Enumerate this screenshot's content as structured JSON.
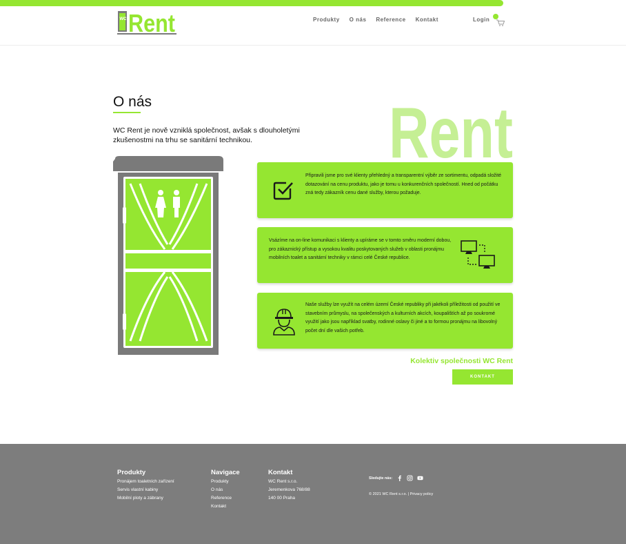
{
  "header": {
    "logo_small": "WC",
    "logo_text": "Rent",
    "nav": [
      "Produkty",
      "O nás",
      "Reference",
      "Kontakt"
    ],
    "login": "Login"
  },
  "main": {
    "title": "O nás",
    "intro": "WC Rent je nově vzniklá společnost, avšak s dlouholetými zkušenostmi na trhu se sanitární technikou.",
    "big_logo": "Rent",
    "cards": [
      {
        "icon": "checkbox-icon",
        "text": "Připravili jsme pro své klienty přehledný a transparentní výběr ze sortimentu, odpadá složité dotazování na cenu produktu, jako je tomu u konkurenčních společností. Hned od počátku zná tedy zákazník cenu dané služby, kterou požaduje."
      },
      {
        "icon": "computers-icon",
        "text": "Vsázíme na on-line komunikaci s klienty a upíráme se v tomto směru moderní dobou, pro zákaznický přístup a vysokou kvalitu poskytovaných služeb v oblasti pronájmu mobilních toalet a sanitární techniky v rámci celé České republice."
      },
      {
        "icon": "worker-icon",
        "text": "Naše služby lze využít na celém území České republiky při jakékoli příležitosti od použití ve stavebním průmyslu, na společenských a kulturních akcích, koupalištích až po soukromé využití jako jsou například svatby, rodinné oslavy či jiné a to formou pronájmu na libovolný počet dní dle vašich potřeb."
      }
    ],
    "signature": "Kolektiv společnosti WC Rent",
    "cta": "KONTAKT"
  },
  "footer": {
    "produkty": {
      "title": "Produkty",
      "items": [
        "Pronájem toaletních zařízení",
        "Servis vlastní kabiny",
        "Mobilní ploty a zábrany"
      ]
    },
    "navigace": {
      "title": "Navigace",
      "items": [
        "Produkty",
        "O nás",
        "Reference",
        "Kontakt"
      ]
    },
    "kontakt": {
      "title": "Kontakt",
      "items": [
        "WC Rent s.r.o.",
        "Jeremenkova 768/88",
        "140 00 Praha"
      ]
    },
    "social_label": "Sledujte nás:",
    "copyright": "© 2021 WC Rent s.r.o.  |  Privacy policy"
  },
  "colors": {
    "accent": "#95e631",
    "footer_bg": "#7d7d7d",
    "cabin_gray": "#7a7a7a"
  }
}
